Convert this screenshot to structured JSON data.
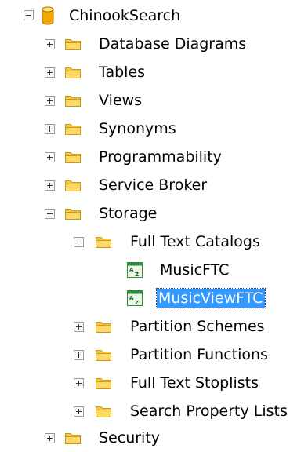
{
  "tree": {
    "root": {
      "label": "ChinookSearch",
      "icon": "database-icon",
      "expanded": true
    },
    "items": [
      {
        "label": "Database Diagrams",
        "icon": "folder-icon",
        "expanded": false
      },
      {
        "label": "Tables",
        "icon": "folder-icon",
        "expanded": false
      },
      {
        "label": "Views",
        "icon": "folder-icon",
        "expanded": false
      },
      {
        "label": "Synonyms",
        "icon": "folder-icon",
        "expanded": false
      },
      {
        "label": "Programmability",
        "icon": "folder-icon",
        "expanded": false
      },
      {
        "label": "Service Broker",
        "icon": "folder-icon",
        "expanded": false
      },
      {
        "label": "Storage",
        "icon": "folder-icon",
        "expanded": true
      },
      {
        "label": "Full Text Catalogs",
        "icon": "folder-icon",
        "expanded": true
      },
      {
        "label": "MusicFTC",
        "icon": "fulltext-catalog-icon"
      },
      {
        "label": "MusicViewFTC",
        "icon": "fulltext-catalog-icon",
        "selected": true
      },
      {
        "label": "Partition Schemes",
        "icon": "folder-icon",
        "expanded": false
      },
      {
        "label": "Partition Functions",
        "icon": "folder-icon",
        "expanded": false
      },
      {
        "label": "Full Text Stoplists",
        "icon": "folder-icon",
        "expanded": false
      },
      {
        "label": "Search Property Lists",
        "icon": "folder-icon",
        "expanded": false
      },
      {
        "label": "Security",
        "icon": "folder-icon",
        "expanded": false
      }
    ]
  },
  "colors": {
    "folder": "#f5c842",
    "database": "#f0a800",
    "catalog": "#2e8b3a",
    "selection": "#3399ff"
  }
}
